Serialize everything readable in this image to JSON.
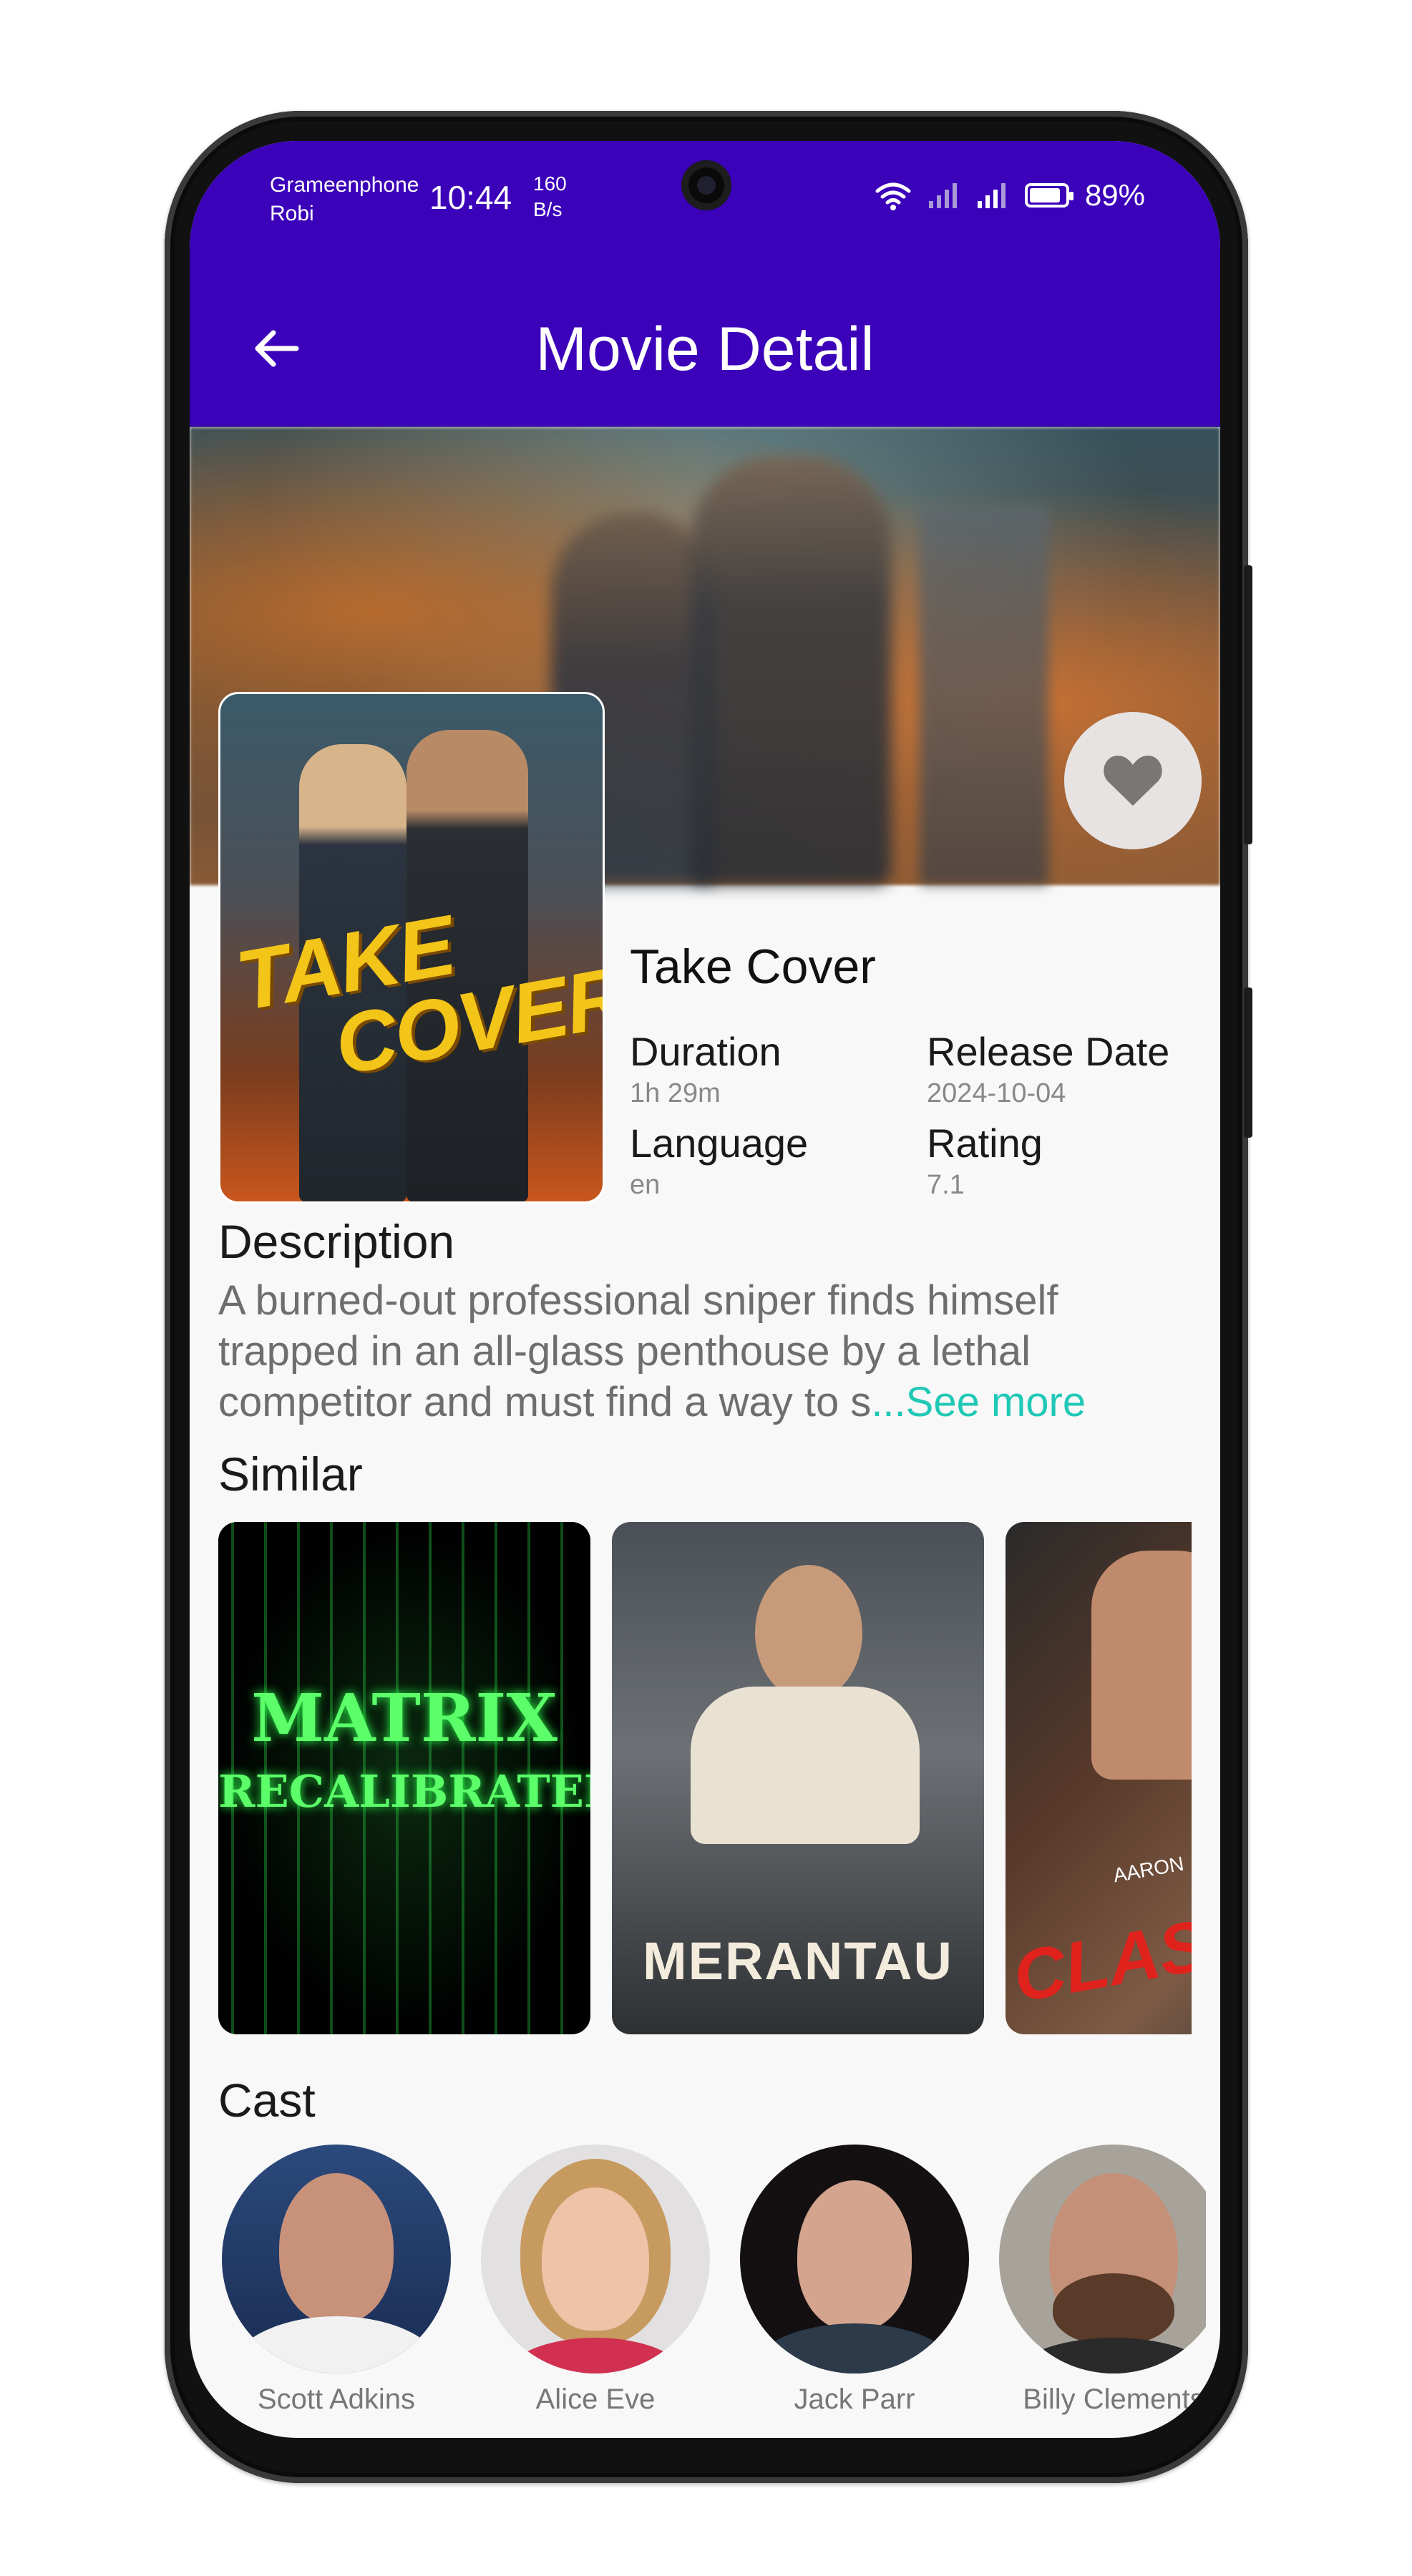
{
  "status_bar": {
    "carrier_1": "Grameenphone",
    "carrier_2": "Robi",
    "time": "10:44",
    "speed_value": "160",
    "speed_unit": "B/s",
    "battery": "89%",
    "battery_level": 0.89
  },
  "app_bar": {
    "title": "Movie Detail",
    "back_icon": "arrow-left-icon"
  },
  "movie": {
    "title": "Take Cover",
    "poster_text_line1": "TAKE",
    "poster_text_line2": "COVER",
    "favorite_icon": "heart-icon",
    "duration_label": "Duration",
    "duration_value": "1h 29m",
    "release_label": "Release Date",
    "release_value": "2024-10-04",
    "language_label": "Language",
    "language_value": "en",
    "rating_label": "Rating",
    "rating_value": "7.1"
  },
  "description": {
    "heading": "Description",
    "text": "A burned-out professional sniper finds himself trapped in an all-glass penthouse by a lethal competitor and must find a way to s",
    "see_more": "...See more"
  },
  "similar": {
    "heading": "Similar",
    "items": [
      {
        "title_line1": "MATRIX",
        "title_line2": "RECALIBRATED"
      },
      {
        "title": "MERANTAU"
      },
      {
        "title": "CLASS",
        "small": "AARON"
      }
    ]
  },
  "cast": {
    "heading": "Cast",
    "members": [
      {
        "name": "Scott Adkins"
      },
      {
        "name": "Alice Eve"
      },
      {
        "name": "Jack Parr"
      },
      {
        "name": "Billy Clements"
      }
    ]
  },
  "colors": {
    "app_bar": "#3b02b9",
    "accent_link": "#20c8b6",
    "background": "#f8f8f8"
  }
}
